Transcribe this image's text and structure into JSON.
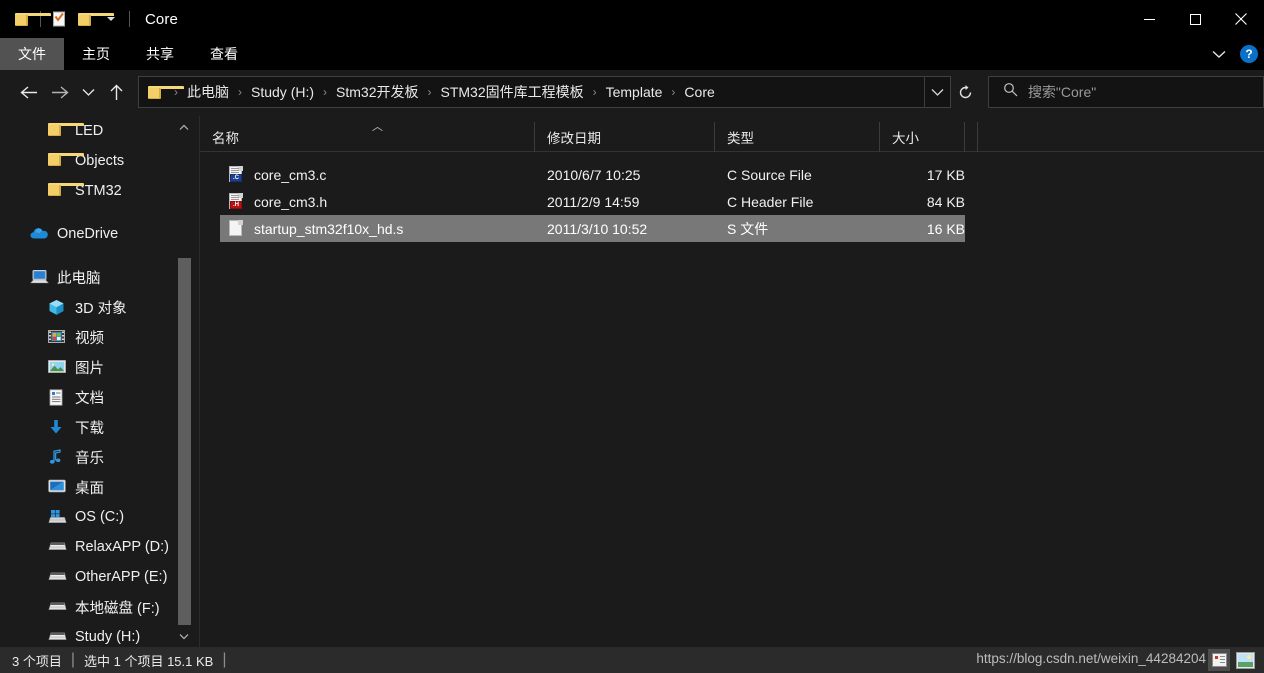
{
  "window": {
    "title": "Core",
    "quick_access": [
      {
        "name": "folder-icon",
        "label": "文件夹"
      },
      {
        "name": "properties-icon",
        "label": "属性"
      },
      {
        "name": "new-folder-icon",
        "label": "新建文件夹"
      },
      {
        "name": "customize-dropdown-icon",
        "label": "自定义快速访问工具栏"
      }
    ],
    "controls": {
      "minimize": "最小化",
      "maximize": "最大化",
      "close": "关闭"
    }
  },
  "ribbon": {
    "tabs": [
      {
        "label": "文件",
        "active": true
      },
      {
        "label": "主页",
        "active": false
      },
      {
        "label": "共享",
        "active": false
      },
      {
        "label": "查看",
        "active": false
      }
    ],
    "collapse_label": "展开功能区",
    "help_label": "?"
  },
  "address": {
    "back_label": "返回",
    "forward_label": "前进",
    "recent_label": "最近位置",
    "up_label": "上移一级",
    "breadcrumbs": [
      "此电脑",
      "Study (H:)",
      "Stm32开发板",
      "STM32固件库工程模板",
      "Template",
      "Core"
    ],
    "dropdown_label": "以前的位置",
    "refresh_label": "刷新",
    "separator": "›"
  },
  "search": {
    "placeholder": "搜索\"Core\"",
    "icon": "search-icon"
  },
  "sidebar": {
    "items": [
      {
        "label": "LED",
        "icon": "folder-icon",
        "indent": 2
      },
      {
        "label": "Objects",
        "icon": "folder-icon",
        "indent": 2
      },
      {
        "label": "STM32",
        "icon": "folder-icon",
        "indent": 2
      },
      {
        "label": "OneDrive",
        "icon": "onedrive-icon",
        "indent": 1,
        "gap_before": true
      },
      {
        "label": "此电脑",
        "icon": "this-pc-icon",
        "indent": 1,
        "gap_before": true
      },
      {
        "label": "3D 对象",
        "icon": "3d-objects-icon",
        "indent": 2
      },
      {
        "label": "视频",
        "icon": "videos-icon",
        "indent": 2
      },
      {
        "label": "图片",
        "icon": "pictures-icon",
        "indent": 2
      },
      {
        "label": "文档",
        "icon": "documents-icon",
        "indent": 2
      },
      {
        "label": "下载",
        "icon": "downloads-icon",
        "indent": 2
      },
      {
        "label": "音乐",
        "icon": "music-icon",
        "indent": 2
      },
      {
        "label": "桌面",
        "icon": "desktop-icon",
        "indent": 2
      },
      {
        "label": "OS (C:)",
        "icon": "os-drive-icon",
        "indent": 2
      },
      {
        "label": "RelaxAPP (D:)",
        "icon": "drive-icon",
        "indent": 2
      },
      {
        "label": "OtherAPP (E:)",
        "icon": "drive-icon",
        "indent": 2
      },
      {
        "label": "本地磁盘 (F:)",
        "icon": "drive-icon",
        "indent": 2
      },
      {
        "label": "Study (H:)",
        "icon": "drive-icon",
        "indent": 2
      }
    ],
    "scroll_up_label": "向上滚动",
    "scroll_down_label": "向下滚动"
  },
  "filelist": {
    "columns": [
      {
        "key": "name",
        "label": "名称",
        "sorted": true,
        "sort_dir": "asc"
      },
      {
        "key": "date",
        "label": "修改日期"
      },
      {
        "key": "type",
        "label": "类型"
      },
      {
        "key": "size",
        "label": "大小"
      }
    ],
    "sort_indicator": "︿",
    "rows": [
      {
        "name": "core_cm3.c",
        "date": "2010/6/7 10:25",
        "type": "C Source File",
        "size": "17 KB",
        "icon": "c-source-file-icon",
        "selected": false
      },
      {
        "name": "core_cm3.h",
        "date": "2011/2/9 14:59",
        "type": "C Header File",
        "size": "84 KB",
        "icon": "c-header-file-icon",
        "selected": false
      },
      {
        "name": "startup_stm32f10x_hd.s",
        "date": "2011/3/10 10:52",
        "type": "S 文件",
        "size": "16 KB",
        "icon": "generic-file-icon",
        "selected": true
      }
    ]
  },
  "statusbar": {
    "item_count": "3 个项目",
    "separator1": "|",
    "selection": "选中 1 个项目  15.1 KB",
    "separator2": "|",
    "watermark": "https://blog.csdn.net/weixin_44284204",
    "view_details_label": "详细信息",
    "view_icons_label": "大图标"
  },
  "colors": {
    "window_bg": "#1b1b1b",
    "titlebar_bg": "#000000",
    "selection": "#787878",
    "accent": "#0a71c8",
    "folder_yellow": "#f3cf6a",
    "text": "#f0f0f0"
  }
}
